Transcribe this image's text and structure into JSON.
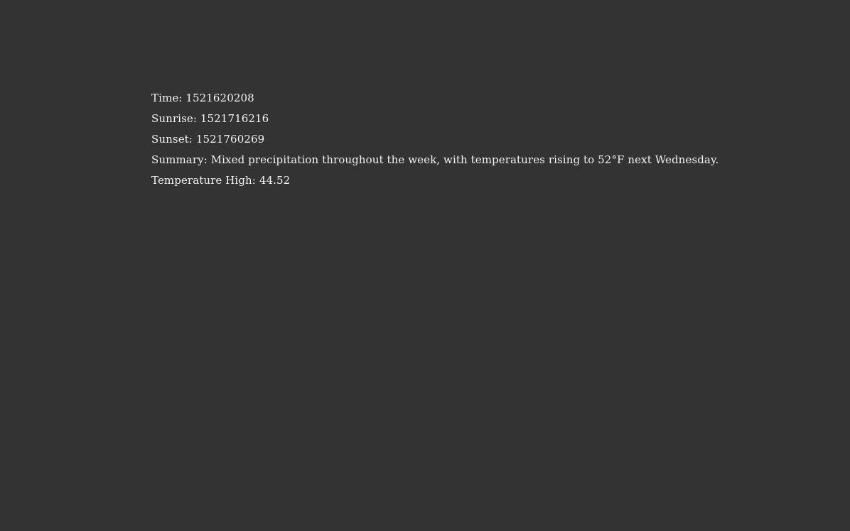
{
  "weather": {
    "time_label": "Time:",
    "time_value": "1521620208",
    "sunrise_label": "Sunrise:",
    "sunrise_value": "1521716216",
    "sunset_label": "Sunset:",
    "sunset_value": "1521760269",
    "summary_label": "Summary:",
    "summary_value": "Mixed precipitation throughout the week, with temperatures rising to 52°F next Wednesday.",
    "temperature_high_label": "Temperature High:",
    "temperature_high_value": "44.52"
  }
}
